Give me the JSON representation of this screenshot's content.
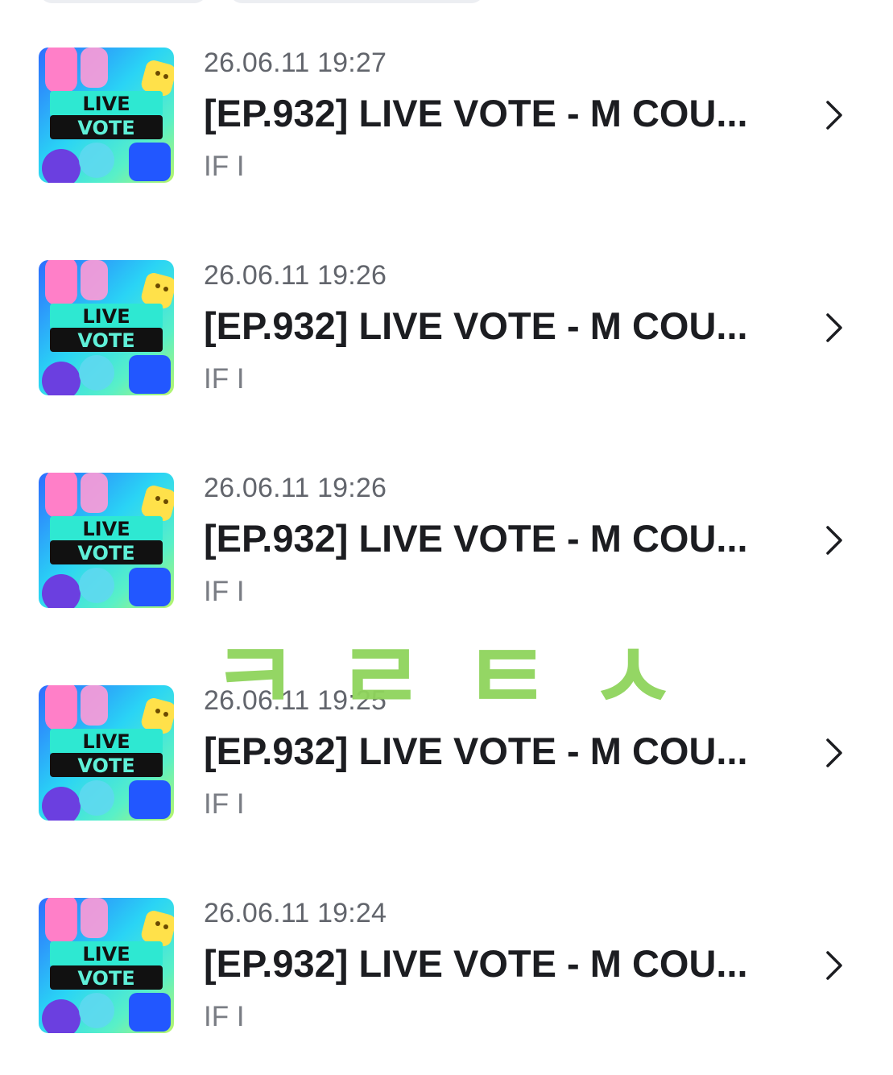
{
  "top_filters": [
    {
      "label": ""
    },
    {
      "label": ""
    }
  ],
  "items": [
    {
      "date": "26.06.11 19:27",
      "title": "[EP.932] LIVE VOTE - M COU...",
      "artist": "IF I",
      "thumb_text_1": "LIVE",
      "thumb_text_2": "VOTE"
    },
    {
      "date": "26.06.11 19:26",
      "title": "[EP.932] LIVE VOTE - M COU...",
      "artist": "IF I",
      "thumb_text_1": "LIVE",
      "thumb_text_2": "VOTE"
    },
    {
      "date": "26.06.11 19:26",
      "title": "[EP.932] LIVE VOTE - M COU...",
      "artist": "IF I",
      "thumb_text_1": "LIVE",
      "thumb_text_2": "VOTE"
    },
    {
      "date": "26.06.11 19:25",
      "title": "[EP.932] LIVE VOTE - M COU...",
      "artist": "IF I",
      "thumb_text_1": "LIVE",
      "thumb_text_2": "VOTE"
    },
    {
      "date": "26.06.11 19:24",
      "title": "[EP.932] LIVE VOTE - M COU...",
      "artist": "IF I",
      "thumb_text_1": "LIVE",
      "thumb_text_2": "VOTE"
    }
  ],
  "icons": {
    "row_action": "chevron-right-icon"
  },
  "watermark": {
    "text": "ㅋㄹㅌㅅ",
    "color": "#8fd45c"
  },
  "colors": {
    "date_text": "#62656c",
    "title_text": "#1c1d21",
    "artist_text": "#7a7d84"
  }
}
